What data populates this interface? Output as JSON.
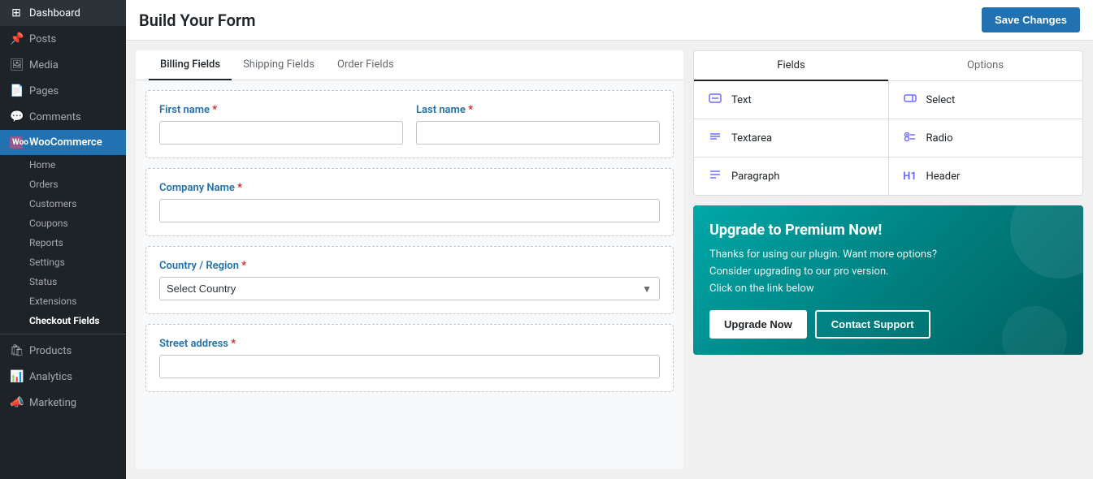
{
  "sidebar": {
    "items": [
      {
        "label": "Dashboard",
        "icon": "⊞",
        "active": false
      },
      {
        "label": "Posts",
        "icon": "📌",
        "active": false
      },
      {
        "label": "Media",
        "icon": "🖼",
        "active": false
      },
      {
        "label": "Pages",
        "icon": "📄",
        "active": false
      },
      {
        "label": "Comments",
        "icon": "💬",
        "active": false
      },
      {
        "label": "WooCommerce",
        "icon": "Woo",
        "active": true,
        "highlighted": true
      },
      {
        "label": "Home",
        "sub": true
      },
      {
        "label": "Orders",
        "sub": true
      },
      {
        "label": "Customers",
        "sub": true
      },
      {
        "label": "Coupons",
        "sub": true
      },
      {
        "label": "Reports",
        "sub": true
      },
      {
        "label": "Settings",
        "sub": true
      },
      {
        "label": "Status",
        "sub": true
      },
      {
        "label": "Extensions",
        "sub": true
      },
      {
        "label": "Checkout Fields",
        "sub": true,
        "activeSub": true
      },
      {
        "label": "Products",
        "icon": "🛍",
        "active": false
      },
      {
        "label": "Analytics",
        "icon": "📊",
        "active": false
      },
      {
        "label": "Marketing",
        "icon": "📣",
        "active": false
      }
    ]
  },
  "topbar": {
    "title": "Build Your Form",
    "save_label": "Save Changes"
  },
  "tabs": [
    {
      "label": "Billing Fields",
      "active": true
    },
    {
      "label": "Shipping Fields",
      "active": false
    },
    {
      "label": "Order Fields",
      "active": false
    }
  ],
  "form": {
    "fields": [
      {
        "type": "two-col",
        "cols": [
          {
            "label": "First name",
            "required": true,
            "inputType": "text"
          },
          {
            "label": "Last name",
            "required": true,
            "inputType": "text"
          }
        ]
      },
      {
        "type": "single",
        "label": "Company Name",
        "required": true,
        "inputType": "text"
      },
      {
        "type": "select",
        "label": "Country / Region",
        "required": true,
        "placeholder": "Select Country"
      },
      {
        "type": "single",
        "label": "Street address",
        "required": true,
        "inputType": "text"
      }
    ]
  },
  "rightPanel": {
    "fieldsTabs": [
      {
        "label": "Fields",
        "active": true
      },
      {
        "label": "Options",
        "active": false
      }
    ],
    "fieldTypes": [
      {
        "label": "Text",
        "icon": "📝"
      },
      {
        "label": "Select",
        "icon": "▭"
      },
      {
        "label": "Textarea",
        "icon": "≡"
      },
      {
        "label": "Radio",
        "icon": "◉"
      },
      {
        "label": "Paragraph",
        "icon": "¶"
      },
      {
        "label": "Header",
        "icon": "H1"
      }
    ],
    "upgrade": {
      "title": "Upgrade to Premium Now!",
      "text": "Thanks for using our plugin. Want more options?\nConsider upgrading to our pro version.\nClick on the link below",
      "btn1": "Upgrade Now",
      "btn2": "Contact Support"
    }
  }
}
